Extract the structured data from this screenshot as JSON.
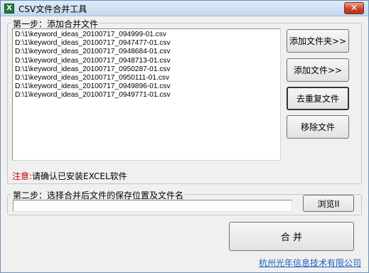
{
  "window": {
    "title": "CSV文件合并工具",
    "close_label": "✕"
  },
  "step1": {
    "legend": "第一步：添加合并文件",
    "files": [
      "D:\\1\\keyword_ideas_20100717_094999-01.csv",
      "D:\\1\\keyword_ideas_20100717_0947477-01.csv",
      "D:\\1\\keyword_ideas_20100717_0948684-01.csv",
      "D:\\1\\keyword_ideas_20100717_0948713-01.csv",
      "D:\\1\\keyword_ideas_20100717_0950287-01.csv",
      "D:\\1\\keyword_ideas_20100717_0950111-01.csv",
      "D:\\1\\keyword_ideas_20100717_0949896-01.csv",
      "D:\\1\\keyword_ideas_20100717_0949771-01.csv"
    ],
    "buttons": {
      "add_folder": "添加文件夹>>",
      "add_file": "添加文件>>",
      "dedupe": "去重复文件",
      "remove": "移除文件"
    }
  },
  "note": {
    "prefix": "注意:",
    "text": "请确认已安装EXCEL软件"
  },
  "step2": {
    "legend": "第二步：选择合并后文件的保存位置及文件名",
    "path_value": "",
    "browse_label": "浏览II"
  },
  "merge_label": "合 并",
  "footer_link": "杭州光年信息技术有限公司",
  "colors": {
    "note_red": "#cc0000",
    "link_blue": "#1f5fbf",
    "window_bg": "#f0f0f0"
  }
}
